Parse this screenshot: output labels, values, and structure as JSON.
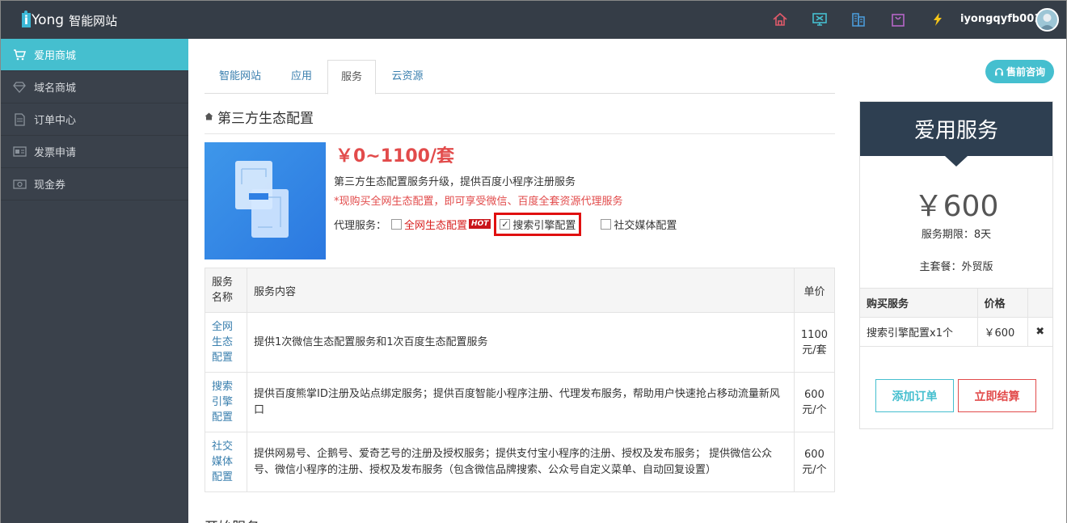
{
  "header": {
    "brand": "Yong",
    "brand_i": "i",
    "subtitle": "智能网站",
    "username": "iyongqyfb001",
    "icons": [
      "home-icon",
      "monitor-icon",
      "building-icon",
      "bag-icon",
      "lightning-icon"
    ]
  },
  "sidebar": {
    "items": [
      {
        "label": "爱用商城",
        "icon": "cart-icon",
        "active": true
      },
      {
        "label": "域名商城",
        "icon": "diamond-icon"
      },
      {
        "label": "订单中心",
        "icon": "document-icon"
      },
      {
        "label": "发票申请",
        "icon": "invoice-icon"
      },
      {
        "label": "现金券",
        "icon": "coupon-icon"
      }
    ]
  },
  "tabs": [
    {
      "label": "智能网站"
    },
    {
      "label": "应用"
    },
    {
      "label": "服务",
      "active": true
    },
    {
      "label": "云资源"
    }
  ],
  "consult_label": "售前咨询",
  "section_title": "第三方生态配置",
  "product": {
    "price": "￥0~1100/套",
    "desc1": "第三方生态配置服务升级，提供百度小程序注册服务",
    "desc2": "*现购买全网生态配置，即可享受微信、百度全套资源代理服务",
    "proxy_label": "代理服务：",
    "options": [
      {
        "label": "全网生态配置",
        "badge": "HOT",
        "checked": false
      },
      {
        "label": "搜索引擎配置",
        "checked": true
      },
      {
        "label": "社交媒体配置",
        "checked": false
      }
    ]
  },
  "table": {
    "headers": {
      "name": "服务名称",
      "content": "服务内容",
      "price": "单价"
    },
    "rows": [
      {
        "name": "全网生态配置",
        "content": "提供1次微信生态配置服务和1次百度生态配置服务",
        "price": "1100元/套"
      },
      {
        "name": "搜索引擎配置",
        "content": "提供百度熊掌ID注册及站点绑定服务；提供百度智能小程序注册、代理发布服务，帮助用户快速抢占移动流量新风口",
        "price": "600元/个"
      },
      {
        "name": "社交媒体配置",
        "content": "提供网易号、企鹅号、爱奇艺号的注册及授权服务；提供支付宝小程序的注册、授权及发布服务； 提供微信公众号、微信小程序的注册、授权及发布服务（包含微信品牌搜索、公众号自定义菜单、自动回复设置）",
        "price": "600元/个"
      }
    ]
  },
  "next_section_partial": "开始服务",
  "panel": {
    "title": "爱用服务",
    "price": "￥600",
    "period": "服务期限：8天",
    "plan": "主套餐：外贸版",
    "table_headers": {
      "service": "购买服务",
      "price": "价格"
    },
    "items": [
      {
        "service": "搜索引擎配置x1个",
        "price": "￥600"
      }
    ],
    "add_label": "添加订单",
    "pay_label": "立即结算"
  }
}
